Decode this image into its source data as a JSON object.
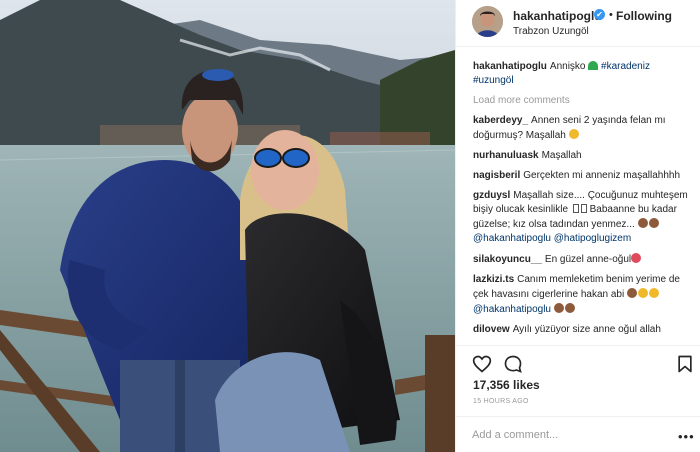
{
  "post": {
    "username": "hakanhatipoglu",
    "follow_state": "Following",
    "dot": "•",
    "location": "Trabzon Uzungöl",
    "verified_glyph": "✔"
  },
  "caption": {
    "username": "hakanhatipoglu",
    "text": "Annişko",
    "hashtags": [
      "#karadeniz",
      "#uzungöl"
    ]
  },
  "load_more": "Load more comments",
  "comments": [
    {
      "username": "kaberdeyy_",
      "text": "Annen seni 2 yaşında felan mı doğurmuş? Maşallah"
    },
    {
      "username": "nurhanuluask",
      "text": "Maşallah"
    },
    {
      "username": "nagisberil",
      "text": "Gerçekten mi anneniz maşallahhhh"
    },
    {
      "username": "gzduysl",
      "text": "Maşallah size.... Çocuğunuz muhteşem bişiy olucak kesinlikle",
      "text2": "Babaanne bu kadar güzelse; kız olsa tadından yenmez...",
      "mentions": [
        "@hakanhatipoglu",
        "@hatipoglugizem"
      ]
    },
    {
      "username": "silakoyuncu__",
      "text": "En güzel anne-oğul"
    },
    {
      "username": "lazkizi.ts",
      "text": "Canım memleketim benim yerime de çek havasını cigerlerine hakan abi",
      "mention": "@hakanhatipoglu"
    },
    {
      "username": "dilovew",
      "text": "Ayılı yüzüyor size anne oğul allah"
    }
  ],
  "likes": "17,356 likes",
  "timestamp": "15 HOURS AGO",
  "add_comment": {
    "placeholder": "Add a comment..."
  },
  "more_glyph": "•••",
  "icons": {
    "like": "heart-outline-icon",
    "comment": "comment-bubble-icon",
    "save": "bookmark-icon",
    "more": "more-options-icon"
  },
  "colors": {
    "accent": "#3897f0",
    "link": "#003569",
    "muted": "#999999",
    "text": "#262626"
  }
}
